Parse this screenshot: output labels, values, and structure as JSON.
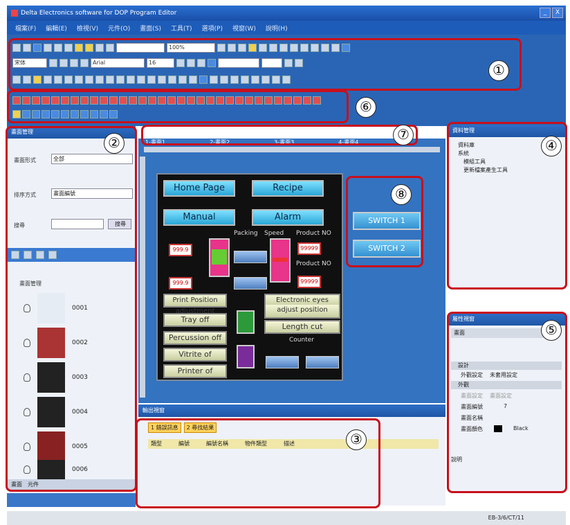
{
  "window": {
    "title": "Delta Electronics software for DOP Program Editor",
    "controls": [
      "_",
      "X"
    ]
  },
  "menu": {
    "items": [
      "檔案(F)",
      "編輯(E)",
      "檢視(V)",
      "元件(O)",
      "畫面(S)",
      "工具(T)",
      "選項(P)",
      "視窗(W)",
      "說明(H)"
    ]
  },
  "toolbar": {
    "font_name": "宋体",
    "font_face": "Arial",
    "font_size": "16",
    "zoom": "100%"
  },
  "left_panel": {
    "title": "畫面管理",
    "display_mode_label": "畫面形式",
    "display_mode_value": "全部",
    "sort_label": "排序方式",
    "sort_value": "畫面編號",
    "search_label": "搜尋",
    "search_button": "搜尋",
    "group_label": "畫面管理",
    "screens": [
      {
        "id": "0001"
      },
      {
        "id": "0002"
      },
      {
        "id": "0003"
      },
      {
        "id": "0004"
      },
      {
        "id": "0005"
      },
      {
        "id": "0006"
      }
    ],
    "tabs": [
      "畫面",
      "元件"
    ]
  },
  "editor_tabs": [
    "1-畫面1",
    "2-畫面2",
    "3-畫面3",
    "4-畫面4"
  ],
  "hmi": {
    "home_page": "Home Page",
    "recipe": "Recipe",
    "manual": "Manual",
    "alarm": "Alarm",
    "packing": "Packing",
    "speed": "Speed",
    "product_no": "Product NO",
    "product_no2": "Product NO",
    "val1": "999.9",
    "val2": "999.9",
    "val3": "99999",
    "val4": "99999",
    "print_position": "Print Position adjustment",
    "electronic_eyes": "Electronic eyes",
    "adjust_position": "adjust position",
    "tray_off": "Tray off",
    "length_cut": "Length cut",
    "percussion_off": "Percussion off",
    "counter": "Counter",
    "vitrite_of": "Vitrite of",
    "printer_of": "Printer of",
    "switch1": "SWITCH 1",
    "switch2": "SWITCH 2"
  },
  "right_top": {
    "title": "資料管理",
    "tree": [
      "資料庫",
      "系統",
      "模組工具",
      "更新檔案產生工具"
    ]
  },
  "right_bottom": {
    "title": "屬性視窗",
    "object": "畫面",
    "sections": [
      "設計",
      "外觀"
    ],
    "rows": [
      {
        "k": "外觀設定",
        "v": "未套用設定"
      },
      {
        "k": "畫面設定",
        "v": "畫面設定"
      },
      {
        "k": "畫面編號",
        "v": "7"
      },
      {
        "k": "畫面名稱",
        "v": ""
      },
      {
        "k": "畫面顏色",
        "v": "Black"
      }
    ],
    "footer": "說明"
  },
  "bottom_panel": {
    "title": "輸出視窗",
    "tabs": [
      "1 錯誤訊息",
      "2 尋找結果"
    ],
    "columns": [
      "類型",
      "編號",
      "編號名稱",
      "物件類型",
      "描述"
    ]
  },
  "status": {
    "right": "EB-3/6/CT/11"
  },
  "callouts": [
    "①",
    "②",
    "③",
    "④",
    "⑤",
    "⑥",
    "⑦",
    "⑧"
  ],
  "colors": {
    "callout_red": "#c8101c",
    "chrome_blue": "#2a65b5"
  }
}
